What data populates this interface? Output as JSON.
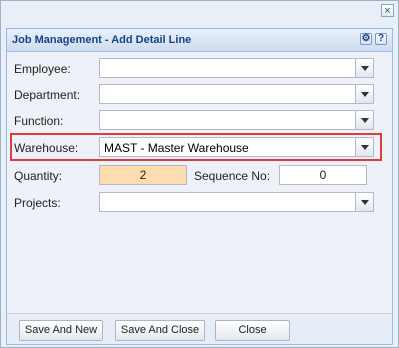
{
  "window": {
    "close_glyph": "×"
  },
  "panel": {
    "title": "Job Management - Add Detail Line",
    "tools": [
      {
        "icon": "gear-icon",
        "glyph": "⚙"
      },
      {
        "icon": "help-icon",
        "glyph": "?"
      }
    ]
  },
  "form": {
    "employee_label": "Employee:",
    "employee_value": "",
    "department_label": "Department:",
    "department_value": "",
    "function_label": "Function:",
    "function_value": "",
    "warehouse_label": "Warehouse:",
    "warehouse_value": "MAST - Master Warehouse",
    "quantity_label": "Quantity:",
    "quantity_value": "2",
    "sequence_label": "Sequence No:",
    "sequence_value": "0",
    "projects_label": "Projects:",
    "projects_value": ""
  },
  "buttons": {
    "save_new": "Save And New",
    "save_close": "Save And Close",
    "close": "Close"
  },
  "colors": {
    "highlight": "#e03c3c",
    "quantity_bg": "#fdddb0",
    "title": "#15428b"
  }
}
